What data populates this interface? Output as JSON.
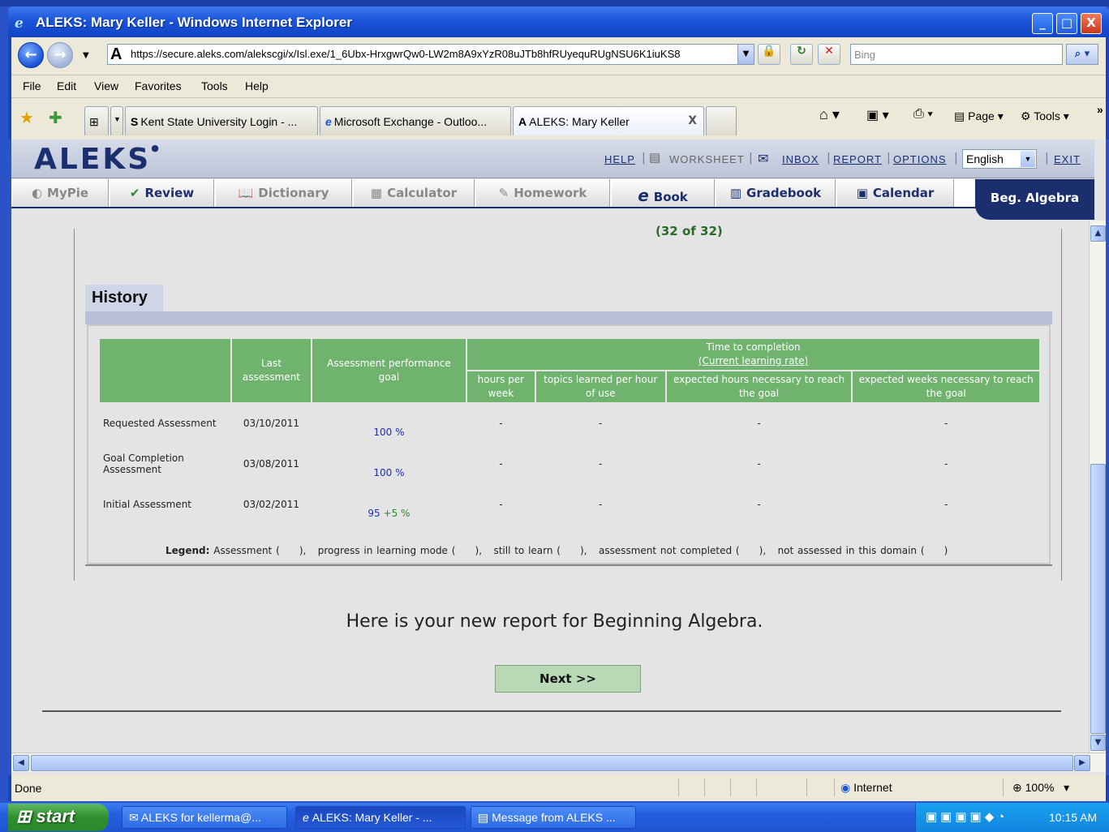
{
  "window": {
    "title": "ALEKS: Mary Keller - Windows Internet Explorer",
    "min": "_",
    "max": "□",
    "close": "X"
  },
  "address": {
    "url": "https://secure.aleks.com/alekscgi/x/Isl.exe/1_6Ubx-HrxgwrQw0-LW2m8A9xYzR08uJTb8hfRUyequRUgNSU6K1iuKS8",
    "search_placeholder": "Bing"
  },
  "menu": [
    "File",
    "Edit",
    "View",
    "Favorites",
    "Tools",
    "Help"
  ],
  "browser_tabs": [
    {
      "label": "Kent State University Login - ...",
      "icon": "S"
    },
    {
      "label": "Microsoft Exchange - Outloo...",
      "icon": "e"
    },
    {
      "label": "ALEKS: Mary Keller",
      "icon": "A",
      "close": "X"
    }
  ],
  "commands": {
    "page": "Page",
    "tools": "Tools"
  },
  "aleks": {
    "logo": "ALEKS",
    "links": {
      "help": "HELP",
      "worksheet": "WORKSHEET",
      "inbox": "INBOX",
      "report": "REPORT",
      "options": "OPTIONS",
      "exit": "EXIT"
    },
    "language": "English",
    "nav": [
      "MyPie",
      "Review",
      "Dictionary",
      "Calculator",
      "Homework",
      "Book",
      "Gradebook",
      "Calendar"
    ],
    "course": "Beg. Algebra"
  },
  "report": {
    "count": "(32 of 32)",
    "history_title": "History",
    "headers": {
      "last": "Last assessment",
      "goal": "Assessment performance goal",
      "time": "Time to completion",
      "rate": "(Current learning rate)",
      "hours": "hours per week",
      "topics": "topics learned per hour of use",
      "exp_hours": "expected hours necessary to reach the goal",
      "exp_weeks": "expected weeks necessary to reach the goal"
    },
    "rows": [
      {
        "name": "Requested Assessment",
        "date": "03/10/2011",
        "goal": "100 %",
        "plus": "",
        "hours": "-",
        "topics": "-",
        "exp_hours": "-",
        "exp_weeks": "-"
      },
      {
        "name": "Goal Completion Assessment",
        "date": "03/08/2011",
        "goal": "100 %",
        "plus": "",
        "hours": "-",
        "topics": "-",
        "exp_hours": "-",
        "exp_weeks": "-"
      },
      {
        "name": "Initial Assessment",
        "date": "03/02/2011",
        "goal": "95",
        "plus": "+5 %",
        "hours": "-",
        "topics": "-",
        "exp_hours": "-",
        "exp_weeks": "-"
      }
    ],
    "legend_label": "Legend:",
    "legend_text": "Assessment (     ),   progress in learning mode (     ),   still to learn (     ),   assessment not completed (     ),   not assessed in this domain (     )",
    "message": "Here is your new report for Beginning Algebra.",
    "next": "Next >>"
  },
  "status": {
    "done": "Done",
    "zone": "Internet",
    "zoom": "100%"
  },
  "taskbar": {
    "start": "start",
    "tasks": [
      "ALEKS for kellerma@...",
      "ALEKS: Mary Keller - ...",
      "Message from ALEKS ..."
    ],
    "clock": "10:15 AM"
  }
}
